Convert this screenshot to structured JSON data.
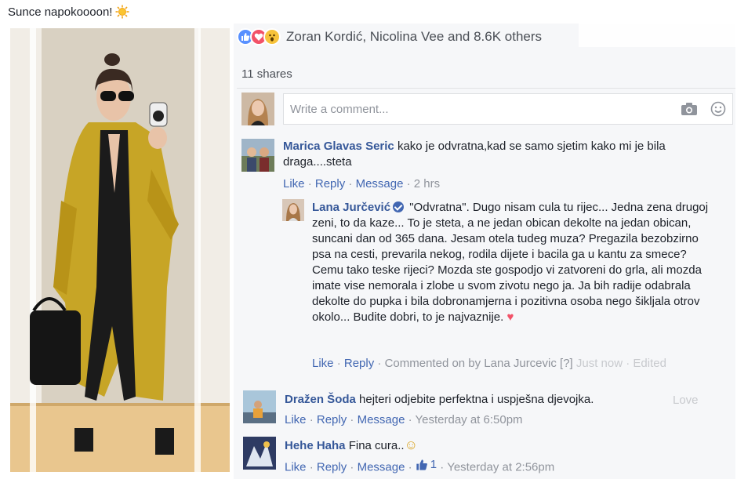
{
  "post": {
    "caption": "Sunce napokoooon!",
    "caption_emoji": "sun-icon"
  },
  "reactions": {
    "icons": [
      "like-icon",
      "love-icon",
      "wow-icon"
    ],
    "names": "Zoran Kordić, Nicolina Vee and 8.6K others"
  },
  "shares": "11 shares",
  "composer": {
    "placeholder": "Write a comment..."
  },
  "comments": [
    {
      "name": "Marica Glavas Seric",
      "text": "kako je odvratna,kad se samo sjetim kako mi je bila draga....steta",
      "actions": [
        "Like",
        "Reply",
        "Message"
      ],
      "time": "2 hrs"
    },
    {
      "name": "Lana Jurčević",
      "verified": true,
      "text": "\"Odvratna\". Dugo nisam cula tu rijec... Jedna zena drugoj zeni, to da kaze... To je steta, a ne jedan obican dekolte na jedan obican, suncani dan od 365 dana. Jesam otela tudeg muza? Pregazila bezobzirno psa na cesti, prevarila nekog, rodila dijete i bacila ga u kantu za smece? Cemu tako teske rijeci? Mozda ste gospodjo vi zatvoreni do grla, ali mozda imate vise nemorala i zlobe u svom zivotu nego ja. Ja bih radije odabrala dekolte do pupka i bila dobronamjerna i pozitivna osoba nego šikljala otrov okolo... Budite dobri, to je najvaznije.",
      "emoji": "♥",
      "actions": [
        "Like",
        "Reply"
      ],
      "meta": "Commented on by Lana Jurcevic [?]",
      "meta_faded": "Just now · Edited"
    },
    {
      "name": "Dražen Šoda",
      "text": "hejteri odjebite perfektna i uspješna djevojka.",
      "actions": [
        "Like",
        "Reply",
        "Message"
      ],
      "time": "Yesterday at 6:50pm",
      "faded_tail": "Love"
    },
    {
      "name": "Hehe Haha",
      "text": "Fina cura..",
      "emoji": "☺",
      "actions": [
        "Like",
        "Reply",
        "Message"
      ],
      "likes": "1",
      "time": "Yesterday at 2:56pm"
    }
  ],
  "colors": {
    "link": "#365899",
    "action": "#4267b2",
    "meta": "#90949c",
    "panel": "#f6f7f9"
  }
}
